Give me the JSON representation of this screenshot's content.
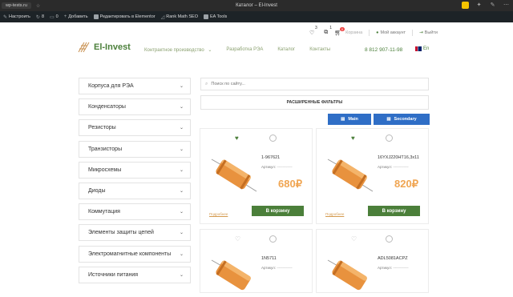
{
  "browser": {
    "url": "wp-tests.ru",
    "window_title": "Каталог – El-Invest"
  },
  "admin_bar": {
    "items": [
      {
        "label": "Настроить",
        "icon": "brush-icon"
      },
      {
        "label": "8",
        "icon": "refresh-icon"
      },
      {
        "label": "0",
        "icon": "comment-icon"
      },
      {
        "label": "Добавить",
        "icon": "plus-icon"
      },
      {
        "label": "Редактировать в Elementor",
        "icon": "elementor-icon"
      },
      {
        "label": "Rank Math SEO",
        "icon": "rankmath-icon"
      },
      {
        "label": "EA Tools",
        "icon": "ea-icon"
      }
    ]
  },
  "header": {
    "logo_text": "El-Invest",
    "wishlist_count": "3",
    "compare_count": "1",
    "cart_count": "0",
    "cart_label": "Корзина",
    "account_label": "Мой аккаунт",
    "logout_label": "Выйти",
    "nav": [
      "Контрактное производство",
      "Разработка РЭА",
      "Каталог",
      "Контакты"
    ],
    "phone": "8 812 907-11-98",
    "lang": "En"
  },
  "sidebar": {
    "categories": [
      "Корпуса для РЭА",
      "Конденсаторы",
      "Резисторы",
      "Транзисторы",
      "Микросхемы",
      "Диоды",
      "Коммутация",
      "Элементы защиты цепей",
      "Электромагнитные компоненты",
      "Источники питания"
    ]
  },
  "search": {
    "placeholder": "Поиск по сайту..."
  },
  "filters": {
    "title": "РАСШИРЕННЫЕ ФИЛЬТРЫ",
    "main_label": "Main",
    "secondary_label": "Secondary"
  },
  "products": [
    {
      "sku": "1-967621",
      "article_label": "Артикул:",
      "article_value": "----------------",
      "price": "680₽",
      "more": "Подробнее",
      "buy": "В корзину",
      "in_wishlist": true
    },
    {
      "sku": "16YXJ220HT16,3x11",
      "article_label": "Артикул:",
      "article_value": "----------------",
      "price": "820₽",
      "more": "Подробнее",
      "buy": "В корзину",
      "in_wishlist": true
    },
    {
      "sku": "1N5711",
      "article_label": "Артикул:",
      "article_value": "----------------",
      "price": "",
      "more": "",
      "buy": "",
      "in_wishlist": false
    },
    {
      "sku": "ADL5081ACPZ",
      "article_label": "Артикул:",
      "article_value": "----------------",
      "price": "",
      "more": "",
      "buy": "",
      "in_wishlist": false
    }
  ],
  "colors": {
    "brand_green": "#4b7f3a",
    "accent_blue": "#2f6ec6",
    "price_orange": "#f0a552",
    "admin_bar": "#1d2327"
  }
}
